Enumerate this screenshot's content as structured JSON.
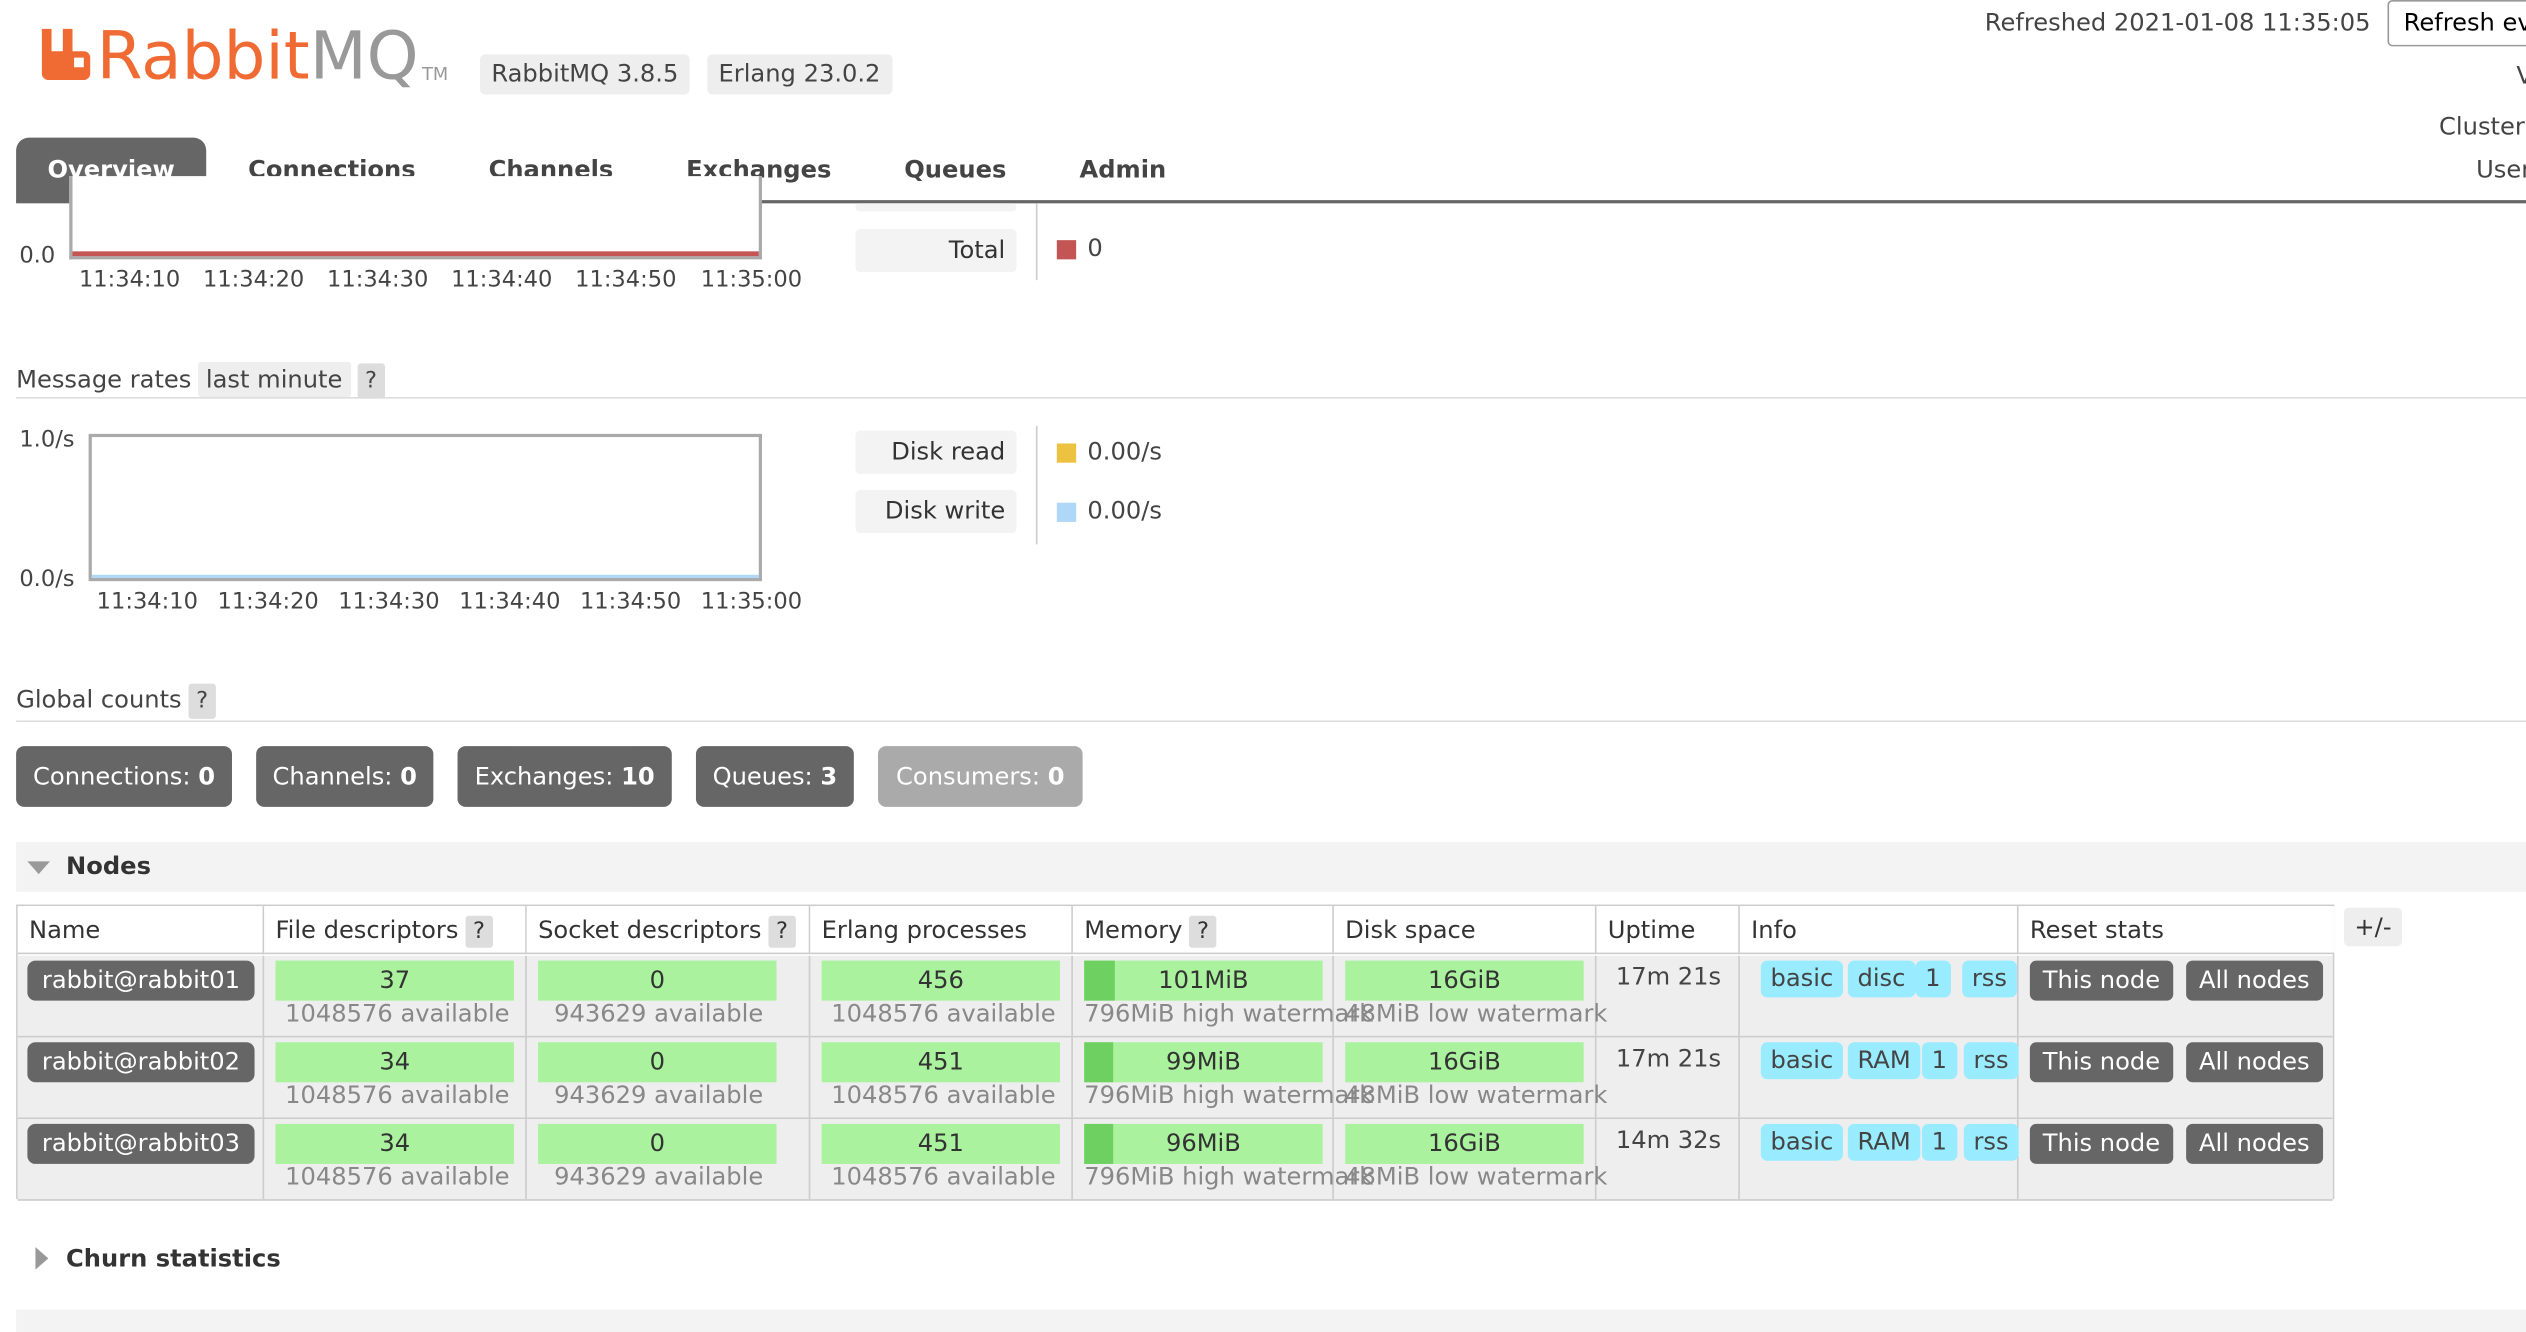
{
  "header": {
    "logo_rabbit": "Rabbit",
    "logo_mq": "MQ",
    "logo_tm": "TM",
    "version_rabbitmq": "RabbitMQ 3.8.5",
    "version_erlang": "Erlang 23.0.2",
    "refreshed": "Refreshed 2021-01-08 11:35:05",
    "refresh_select": "Refresh every",
    "right_v": "V",
    "right_cluster": "Cluster",
    "right_user": "User"
  },
  "tabs": [
    {
      "label": "Overview",
      "active": true
    },
    {
      "label": "Connections",
      "active": false
    },
    {
      "label": "Channels",
      "active": false
    },
    {
      "label": "Exchanges",
      "active": false
    },
    {
      "label": "Queues",
      "active": false
    },
    {
      "label": "Admin",
      "active": false
    }
  ],
  "top_chart": {
    "y_min_label": "0.0",
    "x_ticks": [
      "11:34:10",
      "11:34:20",
      "11:34:30",
      "11:34:40",
      "11:34:50",
      "11:35:00"
    ],
    "legend": [
      {
        "label": "Total",
        "value": "0",
        "color": "#c35555"
      }
    ]
  },
  "message_rates": {
    "title": "Message rates",
    "period": "last minute",
    "help": "?",
    "y_max_label": "1.0/s",
    "y_min_label": "0.0/s",
    "x_ticks": [
      "11:34:10",
      "11:34:20",
      "11:34:30",
      "11:34:40",
      "11:34:50",
      "11:35:00"
    ],
    "legend": [
      {
        "label": "Disk read",
        "value": "0.00/s",
        "color": "#edc240"
      },
      {
        "label": "Disk write",
        "value": "0.00/s",
        "color": "#afd8f8"
      }
    ]
  },
  "global_counts": {
    "title": "Global counts",
    "help": "?",
    "items": [
      {
        "label": "Connections:",
        "value": "0"
      },
      {
        "label": "Channels:",
        "value": "0"
      },
      {
        "label": "Exchanges:",
        "value": "10"
      },
      {
        "label": "Queues:",
        "value": "3"
      },
      {
        "label": "Consumers:",
        "value": "0"
      }
    ]
  },
  "nodes": {
    "title": "Nodes",
    "columns": [
      "Name",
      "File descriptors",
      "Socket descriptors",
      "Erlang processes",
      "Memory",
      "Disk space",
      "Uptime",
      "Info",
      "Reset stats"
    ],
    "help": "?",
    "plus_minus": "+/-",
    "rows": [
      {
        "name": "rabbit@rabbit01",
        "fd": "37",
        "fd_avail": "1048576 available",
        "sd": "0",
        "sd_avail": "943629 available",
        "ep": "456",
        "ep_avail": "1048576 available",
        "mem": "101MiB",
        "mem_sub": "796MiB high watermark",
        "mem_fraction": 0.127,
        "disk": "16GiB",
        "disk_sub": "48MiB low watermark",
        "uptime": "17m 21s",
        "info": [
          "basic",
          "disc",
          "1",
          "rss"
        ],
        "reset_this": "This node",
        "reset_all": "All nodes"
      },
      {
        "name": "rabbit@rabbit02",
        "fd": "34",
        "fd_avail": "1048576 available",
        "sd": "0",
        "sd_avail": "943629 available",
        "ep": "451",
        "ep_avail": "1048576 available",
        "mem": "99MiB",
        "mem_sub": "796MiB high watermark",
        "mem_fraction": 0.124,
        "disk": "16GiB",
        "disk_sub": "48MiB low watermark",
        "uptime": "17m 21s",
        "info": [
          "basic",
          "RAM",
          "1",
          "rss"
        ],
        "reset_this": "This node",
        "reset_all": "All nodes"
      },
      {
        "name": "rabbit@rabbit03",
        "fd": "34",
        "fd_avail": "1048576 available",
        "sd": "0",
        "sd_avail": "943629 available",
        "ep": "451",
        "ep_avail": "1048576 available",
        "mem": "96MiB",
        "mem_sub": "796MiB high watermark",
        "mem_fraction": 0.121,
        "disk": "16GiB",
        "disk_sub": "48MiB low watermark",
        "uptime": "14m 32s",
        "info": [
          "basic",
          "RAM",
          "1",
          "rss"
        ],
        "reset_this": "This node",
        "reset_all": "All nodes"
      }
    ]
  },
  "churn": {
    "title": "Churn statistics"
  }
}
